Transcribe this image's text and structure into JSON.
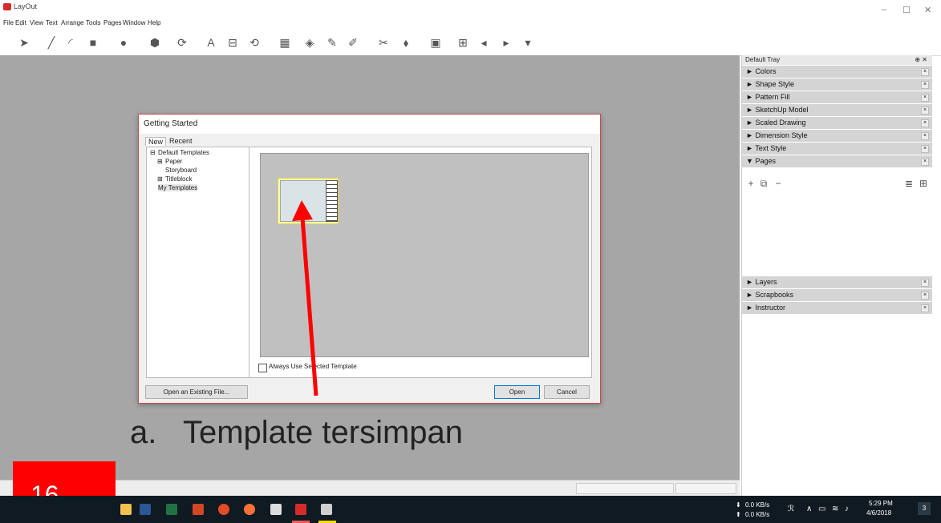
{
  "app": {
    "title": "LayOut",
    "minimize": "–",
    "maximize": "☐",
    "close": "✕"
  },
  "menu": [
    "File",
    "Edit",
    "View",
    "Text",
    "Arrange",
    "Tools",
    "Pages",
    "Window",
    "Help"
  ],
  "tray": {
    "title": "Default Tray",
    "pin": "⊕ ✕",
    "items": [
      "Colors",
      "Shape Style",
      "Pattern Fill",
      "SketchUp Model",
      "Scaled Drawing",
      "Dimension Style",
      "Text Style",
      "Pages"
    ],
    "lower_items": [
      "Layers",
      "Scrapbooks",
      "Instructor"
    ],
    "collapsed_arrow": "►",
    "expanded_arrow": "▼"
  },
  "dialog": {
    "title": "Getting Started",
    "tabs": [
      "New",
      "Recent"
    ],
    "tree": {
      "root": "Default Templates",
      "children": [
        "Paper",
        "Storyboard",
        "Titleblock"
      ],
      "my": "My Templates"
    },
    "checkbox_label": "Always Use Selected Template",
    "open_existing": "Open an Existing File...",
    "open": "Open",
    "cancel": "Cancel"
  },
  "caption": "a.   Template tersimpan",
  "slide_number": "16",
  "taskbar": {
    "net_down": "0.0 KB/s",
    "net_up": "0.0 KB/s",
    "time": "5:29 PM",
    "date": "4/6/2018",
    "notif_count": "3"
  }
}
